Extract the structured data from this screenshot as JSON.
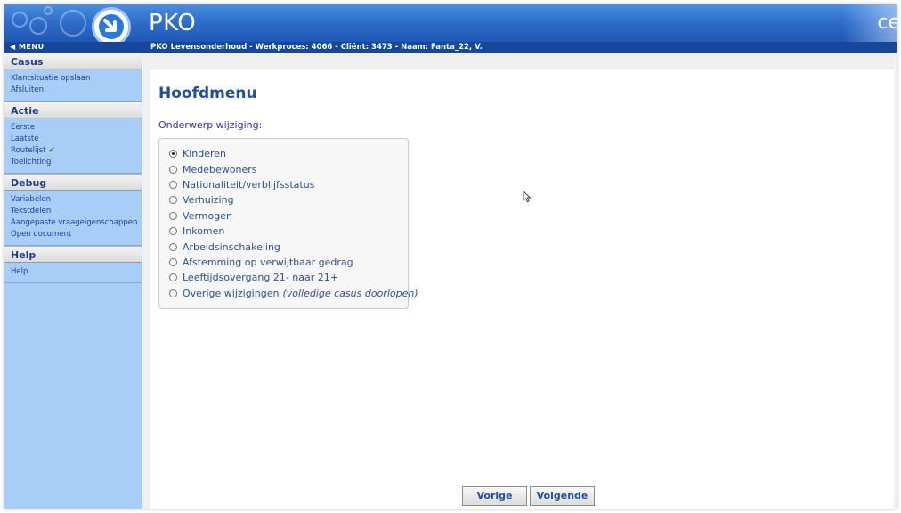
{
  "header": {
    "app_title": "PKO",
    "brand_fragment": "ce",
    "logo_icon": "arrow-down-right-icon"
  },
  "subbar": {
    "menu_label": "MENU",
    "breadcrumb": "PKO Levensonderhoud - Werkproces: 4066 - Cliënt: 3473 - Naam: Fanta_22, V."
  },
  "sidebar": {
    "sections": [
      {
        "title": "Casus",
        "items": [
          "Klantsituatie opslaan",
          "Afsluiten"
        ]
      },
      {
        "title": "Actie",
        "items": [
          "Eerste",
          "Laatste",
          "Routelijst",
          "Toelichting"
        ]
      },
      {
        "title": "Debug",
        "items": [
          "Variabelen",
          "Tekstdelen",
          "Aangepaste vraageigenschappen",
          "Open document"
        ]
      },
      {
        "title": "Help",
        "items": [
          "Help"
        ]
      }
    ]
  },
  "main": {
    "title": "Hoofdmenu",
    "question": "Onderwerp wijziging:",
    "options": [
      {
        "label": "Kinderen",
        "selected": true
      },
      {
        "label": "Medebewoners",
        "selected": false
      },
      {
        "label": "Nationaliteit/verblijfsstatus",
        "selected": false
      },
      {
        "label": "Verhuizing",
        "selected": false
      },
      {
        "label": "Vermogen",
        "selected": false
      },
      {
        "label": "Inkomen",
        "selected": false
      },
      {
        "label": "Arbeidsinschakeling",
        "selected": false
      },
      {
        "label": "Afstemming op verwijtbaar gedrag",
        "selected": false
      },
      {
        "label": "Leeftijdsovergang 21- naar 21+",
        "selected": false
      },
      {
        "label": "Overige wijzigingen",
        "note": "(volledige casus doorlopen)",
        "selected": false
      }
    ],
    "buttons": {
      "prev": "Vorige",
      "next": "Volgende"
    }
  },
  "colors": {
    "header_blue": "#2f6fcc",
    "subbar_blue": "#17479c",
    "sidebar_blue": "#a8cdf7",
    "title_blue": "#1f4f9e",
    "question_blue": "#2d2dcf",
    "check_green": "#2e9a2e"
  }
}
